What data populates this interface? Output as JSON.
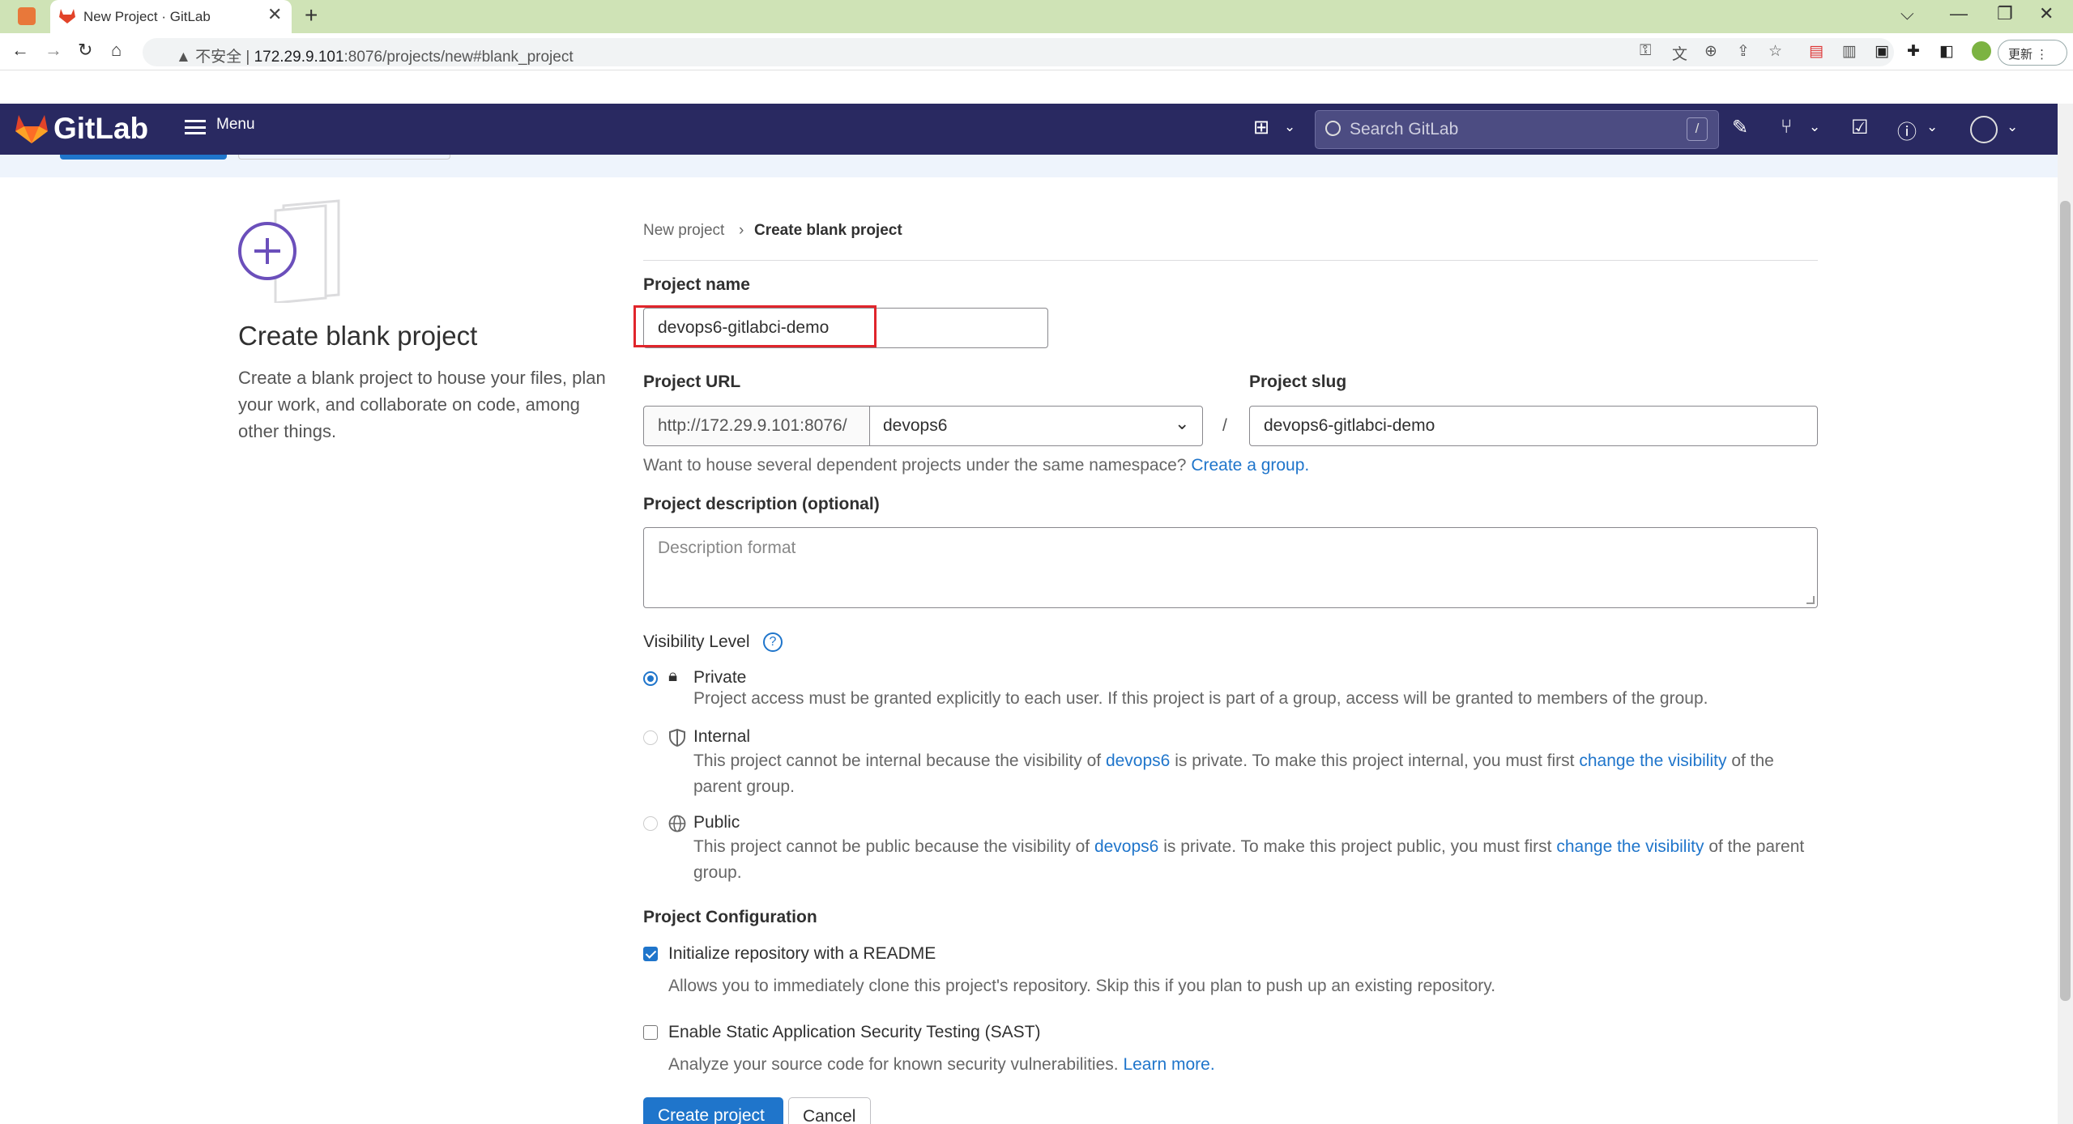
{
  "browser": {
    "tab_title": "New Project · GitLab",
    "tab_close": "✕",
    "new_tab": "+",
    "url_prefix": "▲ 不安全 | ",
    "url_host": "172.29.9.101",
    "url_path": ":8076/projects/new#blank_project",
    "update_label": "更新 ⋮"
  },
  "gitlab": {
    "logo_text": "GitLab",
    "menu_label": "Menu",
    "search_placeholder": "Search GitLab",
    "search_shortcut": "/"
  },
  "left_panel": {
    "title": "Create blank project",
    "description": "Create a blank project to house your files, plan your work, and collaborate on code, among other things."
  },
  "breadcrumb": {
    "parent": "New project",
    "separator": "›",
    "current": "Create blank project"
  },
  "form": {
    "project_name_label": "Project name",
    "project_name_value": "devops6-gitlabci-demo",
    "project_url_label": "Project URL",
    "url_prefix": "http://172.29.9.101:8076/",
    "namespace_value": "devops6",
    "slash": "/",
    "project_slug_label": "Project slug",
    "project_slug_value": "devops6-gitlabci-demo",
    "group_hint": "Want to house several dependent projects under the same namespace?",
    "create_group_link": "Create a group.",
    "description_label": "Project description (optional)",
    "description_placeholder": "Description format",
    "visibility_label": "Visibility Level",
    "visibility": [
      {
        "name": "Private",
        "selected": true,
        "desc": "Project access must be granted explicitly to each user. If this project is part of a group, access will be granted to members of the group."
      },
      {
        "name": "Internal",
        "selected": false,
        "desc_a": "This project cannot be internal because the visibility of",
        "desc_link1": "devops6",
        "desc_b": "is private. To make this project internal, you must first",
        "desc_link2": "change the visibility",
        "desc_c": "of the parent group."
      },
      {
        "name": "Public",
        "selected": false,
        "desc_a": "This project cannot be public because the visibility of",
        "desc_link1": "devops6",
        "desc_b": "is private. To make this project public, you must first",
        "desc_link2": "change the visibility",
        "desc_c": "of the parent group."
      }
    ],
    "config_label": "Project Configuration",
    "readme_label": "Initialize repository with a README",
    "readme_checked": true,
    "readme_desc": "Allows you to immediately clone this project's repository. Skip this if you plan to push up an existing repository.",
    "sast_label": "Enable Static Application Security Testing (SAST)",
    "sast_checked": false,
    "sast_desc": "Analyze your source code for known security vulnerabilities.",
    "learn_more": "Learn more.",
    "create_button": "Create project",
    "cancel_button": "Cancel"
  },
  "colors": {
    "header_bg": "#292961",
    "primary": "#1f75cb",
    "highlight": "#e0252b"
  }
}
